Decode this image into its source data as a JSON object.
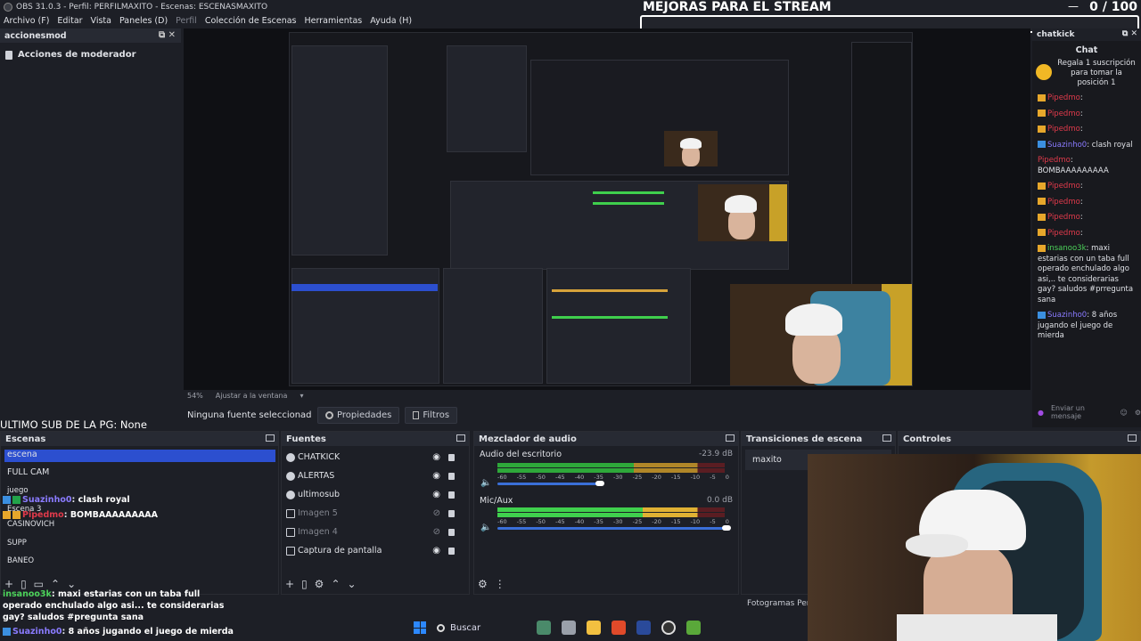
{
  "window": {
    "title": "OBS 31.0.3 - Perfil: PERFILMAXITO - Escenas: ESCENASMAXITO"
  },
  "menu": [
    {
      "label": "Archivo (F)",
      "dim": false
    },
    {
      "label": "Editar",
      "dim": false
    },
    {
      "label": "Vista",
      "dim": false
    },
    {
      "label": "Paneles (D)",
      "dim": false
    },
    {
      "label": "Perfil",
      "dim": true
    },
    {
      "label": "Colección de Escenas",
      "dim": false
    },
    {
      "label": "Herramientas",
      "dim": false
    },
    {
      "label": "Ayuda (H)",
      "dim": false
    }
  ],
  "goal": {
    "title": "MEJORAS PARA EL STREAM",
    "current": "0",
    "total": "/ 100",
    "progress": 0
  },
  "left_dock": {
    "title": "accionesmod",
    "item": "Acciones de moderador"
  },
  "preview": {
    "zoom": "54%",
    "fit": "Ajustar a la ventana"
  },
  "source_toolbar": {
    "none": "Ninguna fuente seleccionada",
    "properties": "Propiedades",
    "filters": "Filtros"
  },
  "last_sub": "ULTIMO SUB DE LA PG: None",
  "scenes": {
    "title": "Escenas",
    "items": [
      "escena",
      "FULL CAM",
      "juego",
      "Escena 3",
      "CASINOVICH",
      "SUPP",
      "BANEO"
    ]
  },
  "sources": {
    "title": "Fuentes",
    "items": [
      {
        "label": "CHATKICK",
        "visible": true
      },
      {
        "label": "ALERTAS",
        "visible": true
      },
      {
        "label": "ultimosub",
        "visible": true
      },
      {
        "label": "Imagen 5",
        "visible": false
      },
      {
        "label": "Imagen 4",
        "visible": false
      },
      {
        "label": "Captura de pantalla",
        "visible": true
      }
    ]
  },
  "mixer": {
    "title": "Mezclador de audio",
    "channels": [
      {
        "label": "Audio del escritorio",
        "db": "-23.9 dB",
        "level": 0.88,
        "volume": 0.45
      },
      {
        "label": "Mic/Aux",
        "db": "0.0 dB",
        "level": 0.64,
        "volume": 1.0
      }
    ],
    "scale": [
      "-60",
      "-55",
      "-50",
      "-45",
      "-40",
      "-35",
      "-30",
      "-25",
      "-20",
      "-15",
      "-10",
      "-5",
      "0"
    ]
  },
  "transitions": {
    "title": "Transiciones de escena",
    "item": "maxito"
  },
  "controls": {
    "title": "Controles"
  },
  "fotogramas": "Fotogramas Perd",
  "chat": {
    "dock_title": "chatkick",
    "title": "Chat",
    "pinned": "Regala 1 suscripción para tomar la posición 1",
    "messages": [
      {
        "user": "Pipedmo",
        "color": "red",
        "text": "",
        "emote": true
      },
      {
        "user": "Pipedmo",
        "color": "red",
        "text": "",
        "emote": true
      },
      {
        "user": "Pipedmo",
        "color": "red",
        "text": "",
        "emote": true
      },
      {
        "user": "Suazinho0",
        "color": "blue",
        "text": "clash royal"
      },
      {
        "user": "Pipedmo",
        "color": "red",
        "text": "BOMBAAAAAAAAA"
      },
      {
        "user": "Pipedmo",
        "color": "red",
        "text": "",
        "emote": true
      },
      {
        "user": "Pipedmo",
        "color": "red",
        "text": "",
        "emote": true
      },
      {
        "user": "Pipedmo",
        "color": "red",
        "text": "",
        "emote": true
      },
      {
        "user": "Pipedmo",
        "color": "red",
        "text": "",
        "emote": true
      },
      {
        "user": "insanoo3k",
        "color": "green",
        "text": "maxi estarias con un taba full operado enchulado algo asi,.. te considerarias gay? saludos #prreguntа sana"
      },
      {
        "user": "Suazinho0",
        "color": "blue",
        "text": "8 años jugando el juego de mierda"
      }
    ],
    "input_placeholder": "Enviar un mensaje"
  },
  "overlay_chat": {
    "line1_user": "Suazinho0",
    "line1_text": "clash royal",
    "line2_user": "Pipedmo",
    "line2_text": "BOMBAAAAAAAAA",
    "long_user": "insanoo3k",
    "long_text": "maxi estarias con un taba full operado enchulado algo asi... te considerarias gay? saludos #pregunta sana",
    "last_user": "Suazinho0",
    "last_text": "8 años jugando el juego de mierda"
  },
  "taskbar": {
    "search": "Buscar"
  }
}
